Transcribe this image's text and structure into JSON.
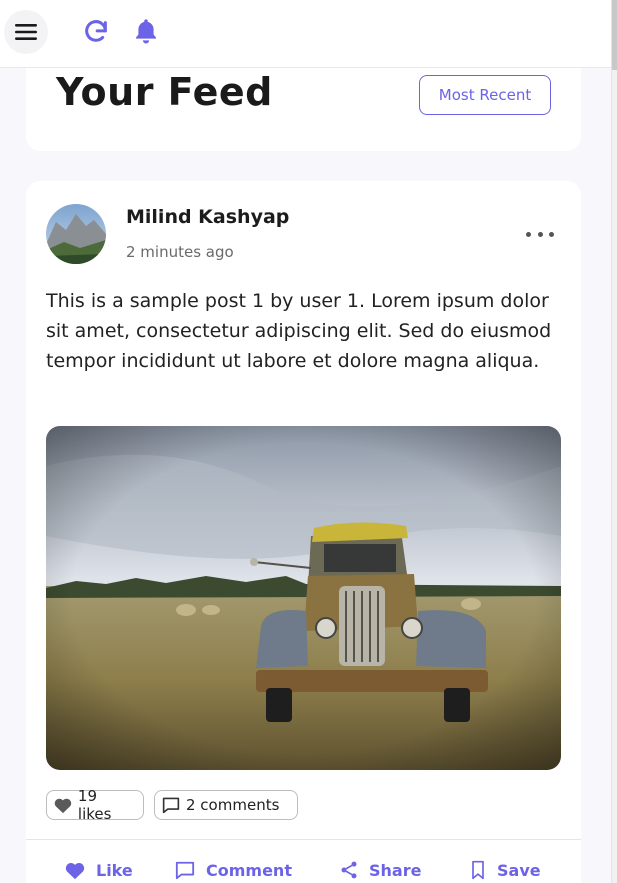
{
  "topbar": {
    "icons": [
      "menu-icon",
      "refresh-icon",
      "bell-icon"
    ],
    "accent_color": "#6c63e6"
  },
  "feed": {
    "title": "Your Feed",
    "sort_label": "Most Recent"
  },
  "post": {
    "author": "Milind Kashyap",
    "time": "2 minutes ago",
    "text": "This is a sample post 1 by user 1. Lorem ipsum dolor sit amet, consectetur adipiscing elit. Sed do eiusmod tempor incididunt ut labore et dolore magna aliqua.",
    "likes": "19 likes",
    "comments": "2 comments",
    "actions": {
      "like": "Like",
      "comment": "Comment",
      "share": "Share",
      "save": "Save"
    }
  }
}
